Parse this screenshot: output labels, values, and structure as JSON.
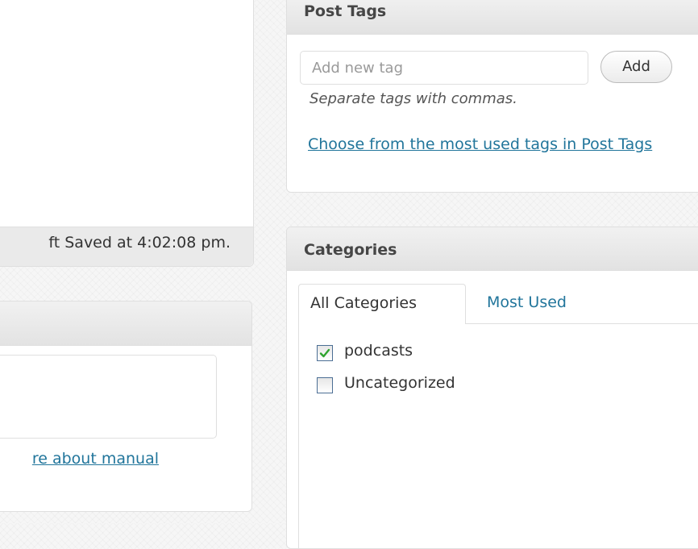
{
  "editor": {
    "status_text": "ft Saved at 4:02:08 pm."
  },
  "excerpt": {
    "link_text": "re about manual"
  },
  "post_tags": {
    "title": "Post Tags",
    "input_placeholder": "Add new tag",
    "input_value": "",
    "add_button_label": "Add",
    "help_text": "Separate tags with commas.",
    "most_used_link": "Choose from the most used tags in Post Tags"
  },
  "categories": {
    "title": "Categories",
    "tabs": [
      {
        "label": "All Categories",
        "active": true
      },
      {
        "label": "Most Used",
        "active": false
      }
    ],
    "items": [
      {
        "label": "podcasts",
        "checked": true
      },
      {
        "label": "Uncategorized",
        "checked": false
      }
    ]
  },
  "colors": {
    "link": "#21759b",
    "checkmark": "#2fa32f",
    "checkbox_border": "#4b6e94"
  },
  "icons": {
    "check": "check-icon"
  }
}
